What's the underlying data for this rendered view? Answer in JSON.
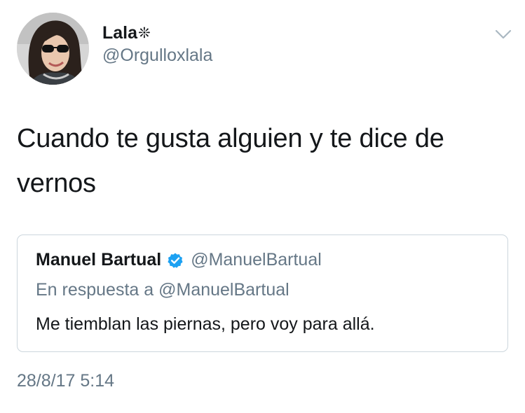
{
  "tweet": {
    "author": {
      "display_name": "Lala",
      "name_glyph": "❊",
      "handle": "@Orgulloxlala",
      "avatar_icon": "profile-photo"
    },
    "menu_icon": "chevron-down-icon",
    "text": "Cuando te gusta alguien y te dice de vernos",
    "timestamp": "28/8/17 5:14"
  },
  "quoted_tweet": {
    "author": {
      "display_name": "Manuel Bartual",
      "verified": true,
      "handle": "@ManuelBartual"
    },
    "reply_context": "En respuesta a @ManuelBartual",
    "text": "Me tiemblan las piernas, pero voy para allá."
  },
  "colors": {
    "primary_text": "#14171a",
    "secondary_text": "#657786",
    "verified_blue": "#1da1f2",
    "border": "#ccd6dd"
  }
}
